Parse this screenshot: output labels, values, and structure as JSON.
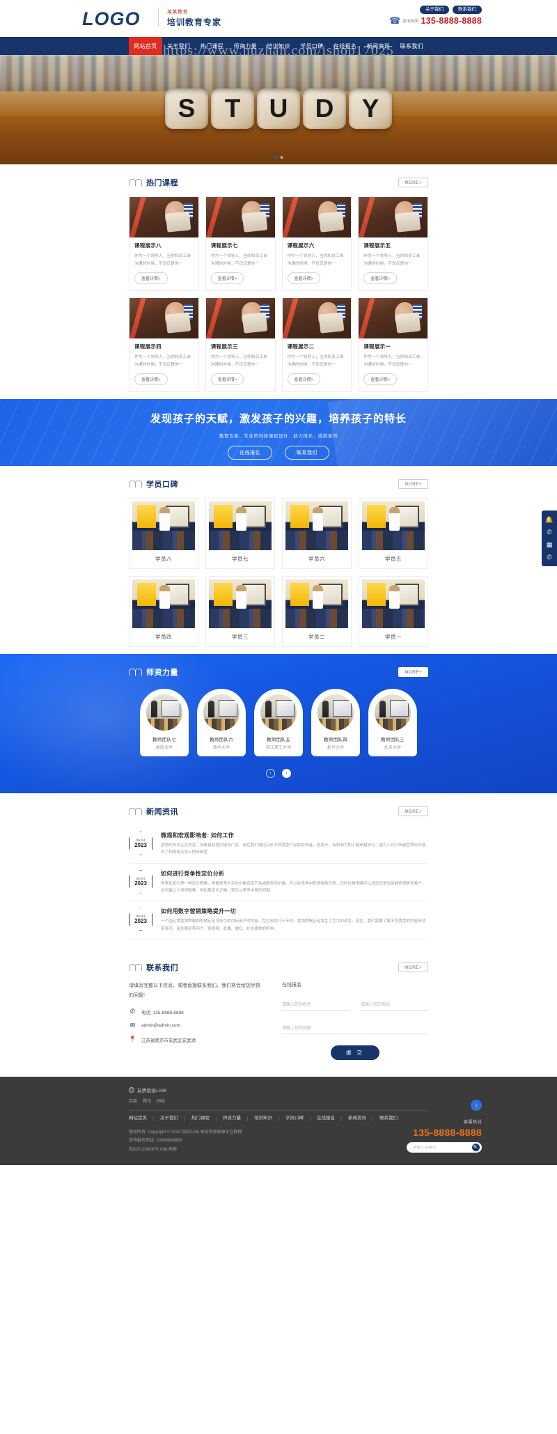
{
  "header": {
    "logo": "LOGO",
    "slogan_small": "某某教育",
    "slogan_large": "培训教育专家",
    "pills": [
      "关于我们",
      "联系我们"
    ],
    "tel_label": "咨询热线:",
    "tel_number": "135-8888-8888"
  },
  "nav": {
    "items": [
      {
        "label": "网站首页",
        "active": true
      },
      {
        "label": "关于我们",
        "active": false
      },
      {
        "label": "热门课程",
        "active": false
      },
      {
        "label": "师资力量",
        "active": false
      },
      {
        "label": "培训知识",
        "active": false
      },
      {
        "label": "学员口碑",
        "active": false
      },
      {
        "label": "在线报名",
        "active": false
      },
      {
        "label": "新闻资讯",
        "active": false
      },
      {
        "label": "联系我们",
        "active": false
      }
    ]
  },
  "watermark": "https://www.huzhan.com/ishop17025",
  "hero": {
    "letters": [
      "S",
      "T",
      "U",
      "D",
      "Y"
    ],
    "dots": 2
  },
  "courses": {
    "title": "热门课程",
    "more": "MORE+",
    "button_label": "查看详情>",
    "items": [
      {
        "title": "课程展示八",
        "desc": "作为一个领导人，当你和员工去沟通的时候，不仅仅是你一"
      },
      {
        "title": "课程展示七",
        "desc": "作为一个领导人，当你和员工去沟通的时候，不仅仅是你一"
      },
      {
        "title": "课程展示六",
        "desc": "作为一个领导人，当你和员工去沟通的时候，不仅仅是你一"
      },
      {
        "title": "课程展示五",
        "desc": "作为一个领导人，当你和员工去沟通的时候，不仅仅是你一"
      },
      {
        "title": "课程展示四",
        "desc": "作为一个领导人，当你和员工去沟通的时候，不仅仅是你一"
      },
      {
        "title": "课程展示三",
        "desc": "作为一个领导人，当你和员工去沟通的时候，不仅仅是你一"
      },
      {
        "title": "课程展示二",
        "desc": "作为一个领导人，当你和员工去沟通的时候，不仅仅是你一"
      },
      {
        "title": "课程展示一",
        "desc": "作为一个领导人，当你和员工去沟通的时候，不仅仅是你一"
      }
    ]
  },
  "cta": {
    "headline": "发现孩子的天赋，激发孩子的兴趣，培养孩子的特长",
    "sub": "教育专家、专业的科技课程设计、助力成长，成绩斐然",
    "btn1": "在线报名",
    "btn2": "联系我们"
  },
  "students": {
    "title": "学员口碑",
    "more": "MORE+",
    "items": [
      {
        "name": "学员八"
      },
      {
        "name": "学员七"
      },
      {
        "name": "学员六"
      },
      {
        "name": "学员五"
      },
      {
        "name": "学员四"
      },
      {
        "name": "学员三"
      },
      {
        "name": "学员二"
      },
      {
        "name": "学员一"
      }
    ]
  },
  "teachers": {
    "title": "师资力量",
    "more": "MORE+",
    "items": [
      {
        "name": "教师团队七",
        "school": "湖南大学"
      },
      {
        "name": "教师团队六",
        "school": "清华大学"
      },
      {
        "name": "教师团队五",
        "school": "浙江理工大学"
      },
      {
        "name": "教师团队四",
        "school": "复旦大学"
      },
      {
        "name": "教师团队三",
        "school": "北京大学"
      }
    ],
    "prev": "‹",
    "next": "›"
  },
  "news": {
    "title": "新闻资讯",
    "more": "MORE+",
    "items": [
      {
        "day": "06-04",
        "year": "2023",
        "title": "微观和宏观影响者: 如何工作",
        "desc": "营销的形式正在改变。如果最初我们借任广告，现在我们借任以价不同类型产品的影响者，这类天，有影响力的人超来越流行，因为人们对传统营销形式感到了相视或杂志上的传统营"
      },
      {
        "day": "06-04",
        "year": "2023",
        "title": "如何进行竞争性定价分析",
        "desc": "竞争性定价是一种定价策略，根据竞争对手的价格设定产品或服务的价格。可以在竞争中获得独特优势，您的价格策略可以决定您是否能够获得更多客户，这可能让人觉得困难，但如果定价正确，就可以带来丰厚的回报。"
      },
      {
        "day": "06-04",
        "year": "2023",
        "title": "如何用数字营销策略提升一切",
        "desc": "一个国心境营销策略和思想定定可吸引的目标用户的内容。在过去的几十年间，营销策略已经发生了巨大的改变。现在，我们需要了解不同类型的内容形式来吸引、留住和培养用户，短视频、直播、微红、社交媒体的影响。"
      }
    ]
  },
  "contact": {
    "title": "联系我们",
    "more": "MORE+",
    "lead": "请填写完整以下信息，或者直接联系我们，我们将会给您尽快的回复!",
    "phone": "电话: 135-8888-8888",
    "email": "admin@admin.com",
    "address": "江苏省南京市玄武区玄武湖",
    "form_title": "在线报名",
    "placeholder_name": "请输入您的姓名",
    "placeholder_phone": "请输入您的电话",
    "placeholder_question": "请输入您的问题",
    "submit": "提 交"
  },
  "footer": {
    "links_title": "友情链接LINK",
    "links": [
      "百度",
      "腾讯",
      "网易"
    ],
    "nav": [
      "网站首页",
      "关于我们",
      "热门课程",
      "师资力量",
      "培训知识",
      "学员口碑",
      "在线报名",
      "新闻资讯",
      "联系我们"
    ],
    "copyright": "版权所有: Copyright © 2023 测试AUdi 本站资源来源于互联网",
    "hotline": "咨询报名热线: 13588888888",
    "icp": "苏ICP12345678 XML地图",
    "right_label": "客服热线",
    "right_tel": "135-8888-8888",
    "search_placeholder": "请输入关键词"
  },
  "side": {
    "items": [
      "bell-icon",
      "phone-icon",
      "qrcode-icon",
      "wechat-icon"
    ]
  },
  "backtop": "↑"
}
